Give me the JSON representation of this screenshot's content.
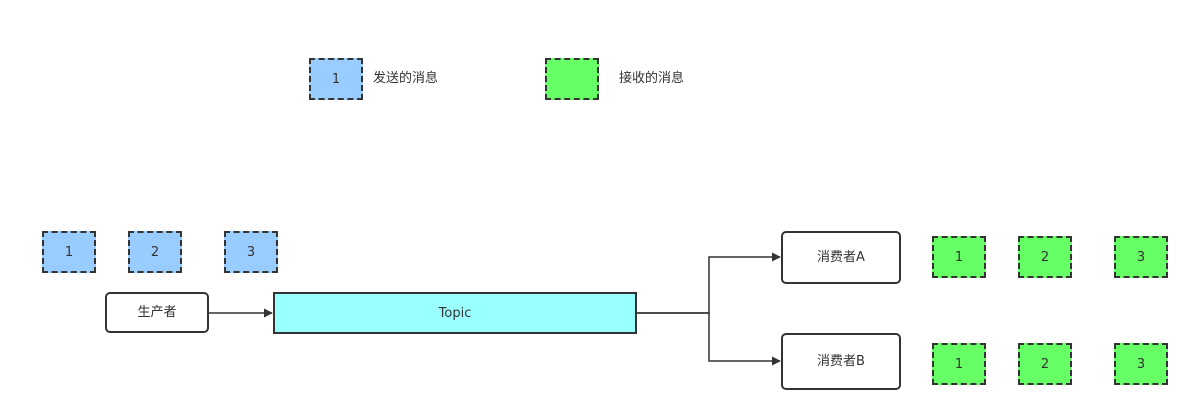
{
  "legend": {
    "sent": {
      "number": "1",
      "label": "发送的消息"
    },
    "received": {
      "number": "",
      "label": "接收的消息"
    }
  },
  "producer": {
    "label": "生产者",
    "messages": [
      "1",
      "2",
      "3"
    ]
  },
  "topic": {
    "label": "Topic"
  },
  "consumers": [
    {
      "label": "消费者A",
      "messages": [
        "1",
        "2",
        "3"
      ]
    },
    {
      "label": "消费者B",
      "messages": [
        "1",
        "2",
        "3"
      ]
    }
  ],
  "colors": {
    "sent_fill": "#99ccff",
    "received_fill": "#66ff66",
    "topic_fill": "#99ffff",
    "stroke": "#333333",
    "text": "#333333"
  }
}
